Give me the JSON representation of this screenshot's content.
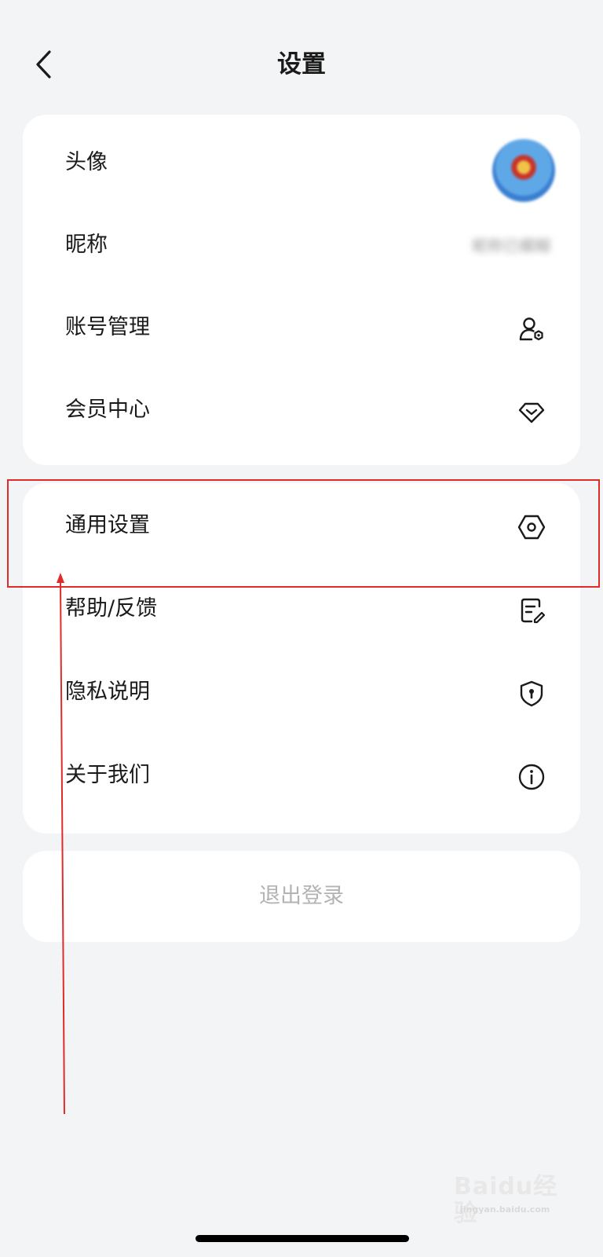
{
  "header": {
    "title": "设置"
  },
  "card1": {
    "items": [
      {
        "label": "头像",
        "icon": "avatar-image"
      },
      {
        "label": "昵称",
        "value": "昵称已模糊",
        "icon": "blurred-text"
      },
      {
        "label": "账号管理",
        "icon": "user-gear-icon"
      },
      {
        "label": "会员中心",
        "icon": "diamond-icon"
      }
    ]
  },
  "card2": {
    "items": [
      {
        "label": "通用设置",
        "icon": "hexagon-settings-icon"
      },
      {
        "label": "帮助/反馈",
        "icon": "feedback-edit-icon"
      },
      {
        "label": "隐私说明",
        "icon": "shield-keyhole-icon"
      },
      {
        "label": "关于我们",
        "icon": "info-circle-icon"
      }
    ]
  },
  "logout": {
    "label": "退出登录"
  },
  "annotation": {
    "color": "#e02b2b",
    "target": "通用设置"
  },
  "watermark": {
    "text": "Baidu经验",
    "sub": "jingyan.baidu.com"
  },
  "colors": {
    "background": "#f3f4f6",
    "card": "#ffffff",
    "text": "#1a1a1a",
    "muted": "#b3b3b3"
  }
}
